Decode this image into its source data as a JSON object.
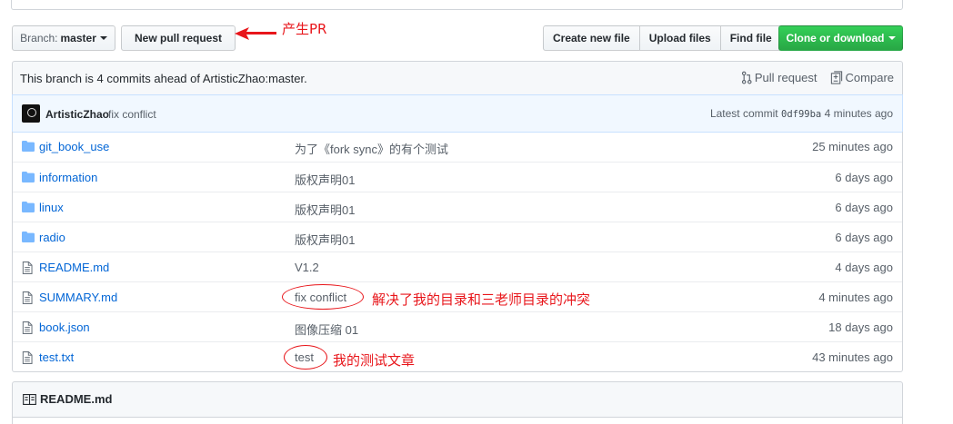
{
  "toolbar": {
    "branch_prefix": "Branch:",
    "branch_name": "master",
    "new_pr": "New pull request",
    "create_file": "Create new file",
    "upload_files": "Upload files",
    "find_file": "Find file",
    "clone": "Clone or download",
    "clone_color": "#28a745"
  },
  "annotations": {
    "pr_note": "产生PR",
    "conflict_note": "解决了我的目录和三老师目录的冲突",
    "test_note": "我的测试文章",
    "color": "#e8161b"
  },
  "branch_status": {
    "text": "This branch is 4 commits ahead of ArtisticZhao:master.",
    "pull_request": "Pull request",
    "compare": "Compare"
  },
  "commit": {
    "author": "ArtisticZhao",
    "message": "fix conflict",
    "latest_label": "Latest commit",
    "sha": "0df99ba",
    "age": "4 minutes ago"
  },
  "files": [
    {
      "type": "folder",
      "icon": "folder-icon",
      "name": "git_book_use",
      "message": "为了《fork sync》的有个测试",
      "age": "25 minutes ago"
    },
    {
      "type": "folder",
      "icon": "folder-icon",
      "name": "information",
      "message": "版权声明01",
      "age": "6 days ago"
    },
    {
      "type": "folder",
      "icon": "folder-icon",
      "name": "linux",
      "message": "版权声明01",
      "age": "6 days ago"
    },
    {
      "type": "folder",
      "icon": "folder-icon",
      "name": "radio",
      "message": "版权声明01",
      "age": "6 days ago"
    },
    {
      "type": "file",
      "icon": "file-icon",
      "name": "README.md",
      "message": "V1.2",
      "age": "4 days ago"
    },
    {
      "type": "file",
      "icon": "file-icon",
      "name": "SUMMARY.md",
      "message": "fix conflict",
      "age": "4 minutes ago"
    },
    {
      "type": "file",
      "icon": "file-icon",
      "name": "book.json",
      "message": "图像压缩 01",
      "age": "18 days ago"
    },
    {
      "type": "file",
      "icon": "file-icon",
      "name": "test.txt",
      "message": "test",
      "age": "43 minutes ago"
    }
  ],
  "readme": {
    "title": "README.md",
    "icon": "book-icon"
  }
}
